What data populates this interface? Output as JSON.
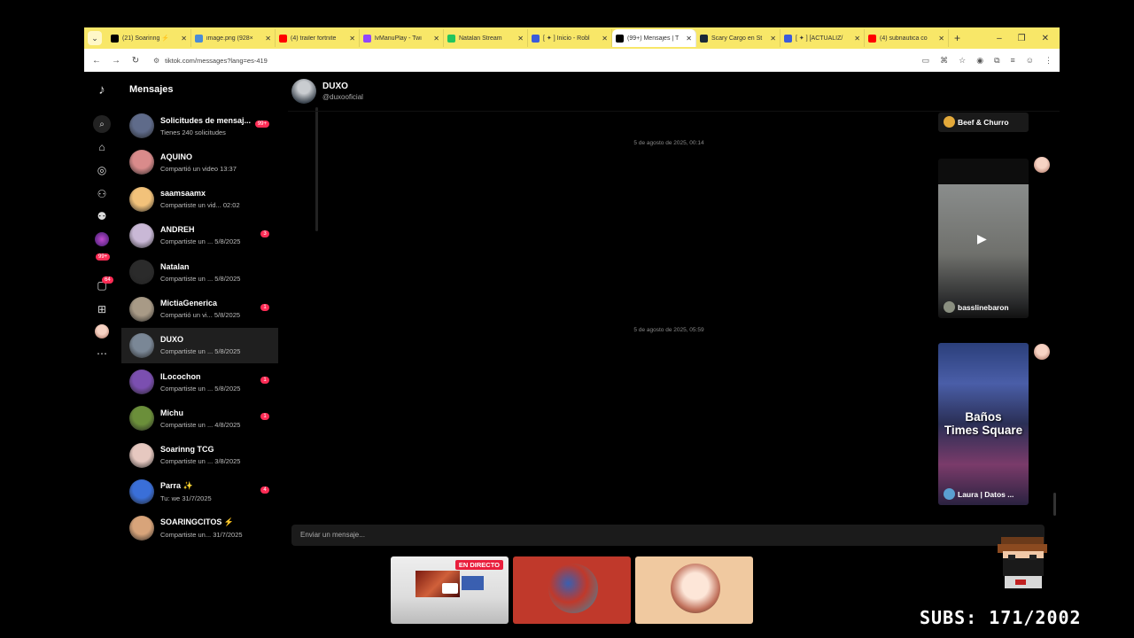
{
  "browser": {
    "tabs": [
      {
        "title": "(21) Soarinng ⚡",
        "color": "#000000"
      },
      {
        "title": "image.png (928×",
        "color": "#4a8bd6"
      },
      {
        "title": "(4) trailer fortnite",
        "color": "#ff0000"
      },
      {
        "title": "lvManuPlay - Twi",
        "color": "#9146ff"
      },
      {
        "title": "Natalan Stream",
        "color": "#22c55e"
      },
      {
        "title": "[ ✦ ] Inicio - Robl",
        "color": "#3b5bdb"
      },
      {
        "title": "(99+) Mensajes | T",
        "color": "#000000",
        "active": true
      },
      {
        "title": "Scary Cargo en St",
        "color": "#1b2838"
      },
      {
        "title": "[ ✦ ] [ACTUALIZ/",
        "color": "#3b5bdb"
      },
      {
        "title": "(4) subnautica co",
        "color": "#ff0000"
      }
    ],
    "url": "tiktok.com/messages?lang=es-419"
  },
  "rail": {
    "badge_99": "99+",
    "badge_64": "64"
  },
  "conversations": {
    "title": "Mensajes",
    "items": [
      {
        "name": "Solicitudes de mensaj...",
        "sub": "Tienes 240 solicitudes",
        "badge": "99+",
        "color": "#5f6b8a"
      },
      {
        "name": "AQUINO",
        "sub": "Compartió un video 13:37",
        "badge": "",
        "color": "#d98b8b"
      },
      {
        "name": "saamsaamx",
        "sub": "Compartiste un vid... 02:02",
        "badge": "",
        "color": "#f2c27a"
      },
      {
        "name": "ANDREH",
        "sub": "Compartiste un ... 5/8/2025",
        "badge": "3",
        "color": "#c9b8d6"
      },
      {
        "name": "Natalan",
        "sub": "Compartiste un ... 5/8/2025",
        "badge": "",
        "color": "#2b2b2b"
      },
      {
        "name": "MictiaGenerica",
        "sub": "Compartió un vi... 5/8/2025",
        "badge": "1",
        "color": "#a89a86"
      },
      {
        "name": "DUXO",
        "sub": "Compartiste un ... 5/8/2025",
        "badge": "",
        "color": "#7a8796",
        "selected": true
      },
      {
        "name": "ILocochon",
        "sub": "Compartiste un ... 5/8/2025",
        "badge": "1",
        "color": "#7b4fb0"
      },
      {
        "name": "Michu",
        "sub": "Compartiste un ... 4/8/2025",
        "badge": "1",
        "color": "#6b8f3a"
      },
      {
        "name": "Soarinng TCG",
        "sub": "Compartiste un ... 3/8/2025",
        "badge": "",
        "color": "#e6c8c0"
      },
      {
        "name": "Parra ✨",
        "sub": "Tu: we 31/7/2025",
        "badge": "4",
        "color": "#3a6fd8"
      },
      {
        "name": "SOARINGCITOS ⚡",
        "sub": "Compartiste un... 31/7/2025",
        "badge": "",
        "color": "#d8a47a"
      }
    ]
  },
  "chat": {
    "name": "DUXO",
    "handle": "@duxooficial",
    "dates": [
      "5 de agosto de 2025, 00:14",
      "5 de agosto de 2025, 05:59"
    ],
    "cards": [
      {
        "label": "Beef & Churro"
      },
      {
        "label": "basslinebaron"
      },
      {
        "label": "Laura | Datos ...",
        "title": "Baños\nTimes Square"
      }
    ],
    "composer_placeholder": "Enviar un mensaje..."
  },
  "overlay": {
    "live_label": "EN DIRECTO",
    "subs": "SUBS: 171/2002"
  }
}
